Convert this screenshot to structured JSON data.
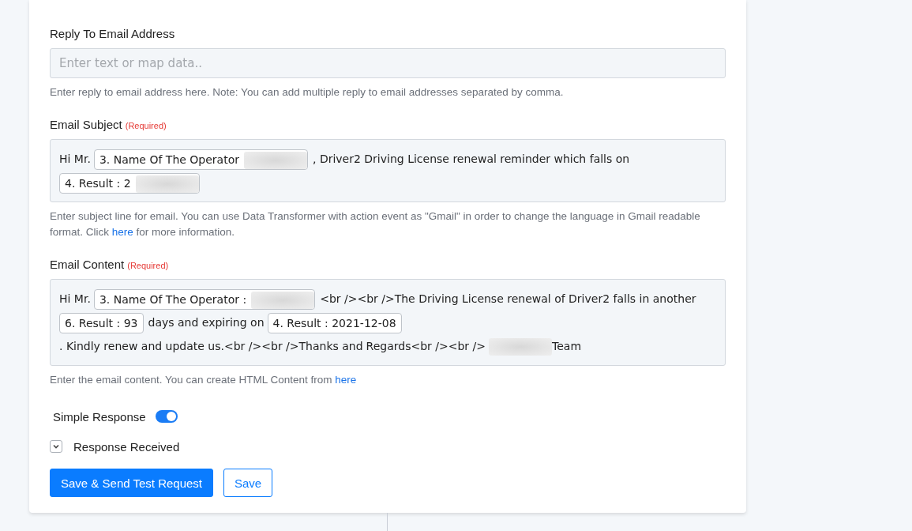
{
  "fields": [
    {
      "kind": "input",
      "label": "Reply To Email Address",
      "placeholder": "Enter text or map data..",
      "help": [
        {
          "kind": "text",
          "text": "Enter reply to email address here. Note: You can add multiple reply to email addresses separated by comma."
        }
      ]
    },
    {
      "kind": "editor",
      "label": "Email Subject",
      "required": "(Required)",
      "content": [
        {
          "kind": "text",
          "text": "Hi Mr."
        },
        {
          "kind": "token",
          "text": "3. Name Of The Operator",
          "blurred": true
        },
        {
          "kind": "text",
          "text": ", Driver2 Driving License renewal reminder which falls on"
        },
        {
          "kind": "token",
          "text": "4. Result : 2",
          "blurred": true
        }
      ],
      "help": [
        {
          "kind": "text",
          "text": "Enter subject line for email. You can use Data Transformer with action event as \"Gmail\" in order to change the language in Gmail readable format. Click "
        },
        {
          "kind": "link",
          "text": "here"
        },
        {
          "kind": "text",
          "text": " for more information."
        }
      ]
    },
    {
      "kind": "editor",
      "label": "Email Content",
      "required": "(Required)",
      "content": [
        {
          "kind": "text",
          "text": "Hi Mr."
        },
        {
          "kind": "token",
          "text": "3. Name Of The Operator :",
          "blurred": true
        },
        {
          "kind": "text",
          "text": "<br /><br />The Driving License renewal of Driver2 falls in another"
        },
        {
          "kind": "token",
          "text": "6. Result : 93",
          "blurred": false
        },
        {
          "kind": "text",
          "text": "days and expiring on"
        },
        {
          "kind": "token",
          "text": "4. Result : 2021-12-08",
          "blurred": false
        },
        {
          "kind": "text",
          "text": ". Kindly renew and update us.<br /><br />Thanks and"
        },
        {
          "kind": "text",
          "text": "Regards<br /><br />"
        },
        {
          "kind": "blur"
        },
        {
          "kind": "text",
          "text": "Team"
        }
      ],
      "help": [
        {
          "kind": "text",
          "text": "Enter the email content. You can create HTML Content from "
        },
        {
          "kind": "link",
          "text": "here"
        }
      ]
    }
  ],
  "options": [
    {
      "kind": "toggle",
      "label": "Simple Response",
      "on": true
    },
    {
      "kind": "expander",
      "label": "Response Received",
      "expanded": false
    }
  ],
  "buttons": [
    {
      "kind": "primary",
      "label": "Save & Send Test Request"
    },
    {
      "kind": "outline",
      "label": "Save"
    }
  ]
}
